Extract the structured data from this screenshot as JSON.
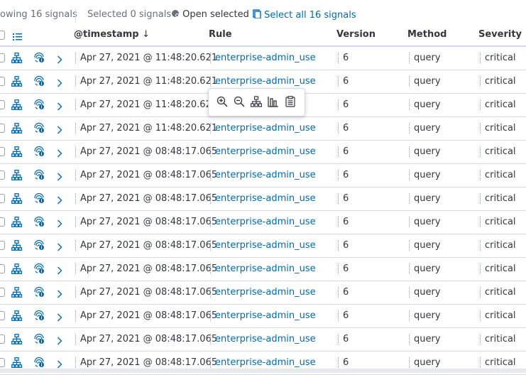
{
  "toolbar": {
    "showing": "owing 16 signals",
    "selected": "Selected 0 signals",
    "open_selected": "Open selected",
    "select_all": "Select all 16 signals"
  },
  "columns": {
    "timestamp": "@timestamp",
    "sort_indicator": "↓",
    "rule": "Rule",
    "version": "Version",
    "method": "Method",
    "severity": "Severity"
  },
  "rows": [
    {
      "timestamp": "Apr 27, 2021 @ 11:48:20.621",
      "rule": "enterprise-admin_use",
      "version": "6",
      "method": "query",
      "severity": "critical"
    },
    {
      "timestamp": "Apr 27, 2021 @ 11:48:20.621",
      "rule": "enterprise-admin_use",
      "version": "6",
      "method": "query",
      "severity": "critical"
    },
    {
      "timestamp": "Apr 27, 2021 @ 11:48:20.621",
      "rule": "",
      "version": "6",
      "method": "query",
      "severity": "critical"
    },
    {
      "timestamp": "Apr 27, 2021 @ 11:48:20.621",
      "rule": "enterprise-admin_use",
      "version": "6",
      "method": "query",
      "severity": "critical"
    },
    {
      "timestamp": "Apr 27, 2021 @ 08:48:17.065",
      "rule": "enterprise-admin_use",
      "version": "6",
      "method": "query",
      "severity": "critical"
    },
    {
      "timestamp": "Apr 27, 2021 @ 08:48:17.065",
      "rule": "enterprise-admin_use",
      "version": "6",
      "method": "query",
      "severity": "critical"
    },
    {
      "timestamp": "Apr 27, 2021 @ 08:48:17.065",
      "rule": "enterprise-admin_use",
      "version": "6",
      "method": "query",
      "severity": "critical"
    },
    {
      "timestamp": "Apr 27, 2021 @ 08:48:17.065",
      "rule": "enterprise-admin_use",
      "version": "6",
      "method": "query",
      "severity": "critical"
    },
    {
      "timestamp": "Apr 27, 2021 @ 08:48:17.065",
      "rule": "enterprise-admin_use",
      "version": "6",
      "method": "query",
      "severity": "critical"
    },
    {
      "timestamp": "Apr 27, 2021 @ 08:48:17.065",
      "rule": "enterprise-admin_use",
      "version": "6",
      "method": "query",
      "severity": "critical"
    },
    {
      "timestamp": "Apr 27, 2021 @ 08:48:17.065",
      "rule": "enterprise-admin_use",
      "version": "6",
      "method": "query",
      "severity": "critical"
    },
    {
      "timestamp": "Apr 27, 2021 @ 08:48:17.065",
      "rule": "enterprise-admin_use",
      "version": "6",
      "method": "query",
      "severity": "critical"
    },
    {
      "timestamp": "Apr 27, 2021 @ 08:48:17.065",
      "rule": "enterprise-admin_use",
      "version": "6",
      "method": "query",
      "severity": "critical"
    },
    {
      "timestamp": "Apr 27, 2021 @ 08:48:17.065",
      "rule": "enterprise-admin_use",
      "version": "6",
      "method": "query",
      "severity": "critical"
    }
  ],
  "popover": {
    "icons": [
      "zoom-in-icon",
      "zoom-out-icon",
      "hierarchy-icon",
      "bar-chart-icon",
      "clipboard-icon"
    ]
  },
  "colors": {
    "link": "#006bb4",
    "text": "#343741",
    "border": "#d3dae6"
  }
}
